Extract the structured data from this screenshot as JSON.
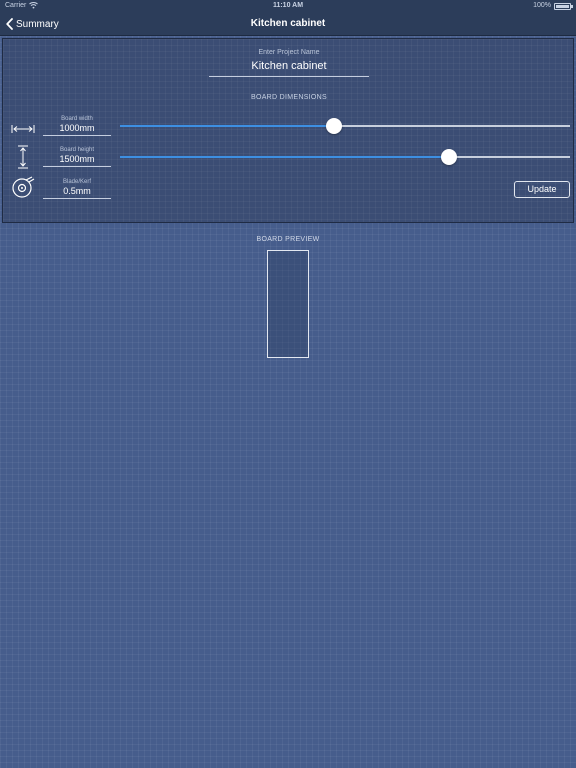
{
  "status_bar": {
    "carrier": "Carrier",
    "time": "11:10 AM",
    "battery": "100%",
    "wifi_icon": "wifi-icon",
    "battery_icon": "battery-icon"
  },
  "nav": {
    "back_label": "Summary",
    "back_icon": "chevron-left-icon",
    "title": "Kitchen cabinet"
  },
  "project": {
    "caption": "Enter Project Name",
    "name": "Kitchen cabinet"
  },
  "board_dimensions": {
    "heading": "BOARD DIMENSIONS",
    "width": {
      "label": "Board width",
      "value": "1000mm",
      "icon": "horizontal-arrows-icon",
      "slider_fraction": 0.475
    },
    "height": {
      "label": "Board height",
      "value": "1500mm",
      "icon": "vertical-arrows-icon",
      "slider_fraction": 0.73
    },
    "kerf": {
      "label": "Blade/Kerf",
      "value": "0.5mm",
      "icon": "saw-blade-icon"
    },
    "update_label": "Update"
  },
  "preview": {
    "heading": "BOARD PREVIEW"
  },
  "colors": {
    "background": "#465d8c",
    "panel": "#3b4d74",
    "nav": "#2c3d5a",
    "slider_fill": "#3d8fe2"
  }
}
